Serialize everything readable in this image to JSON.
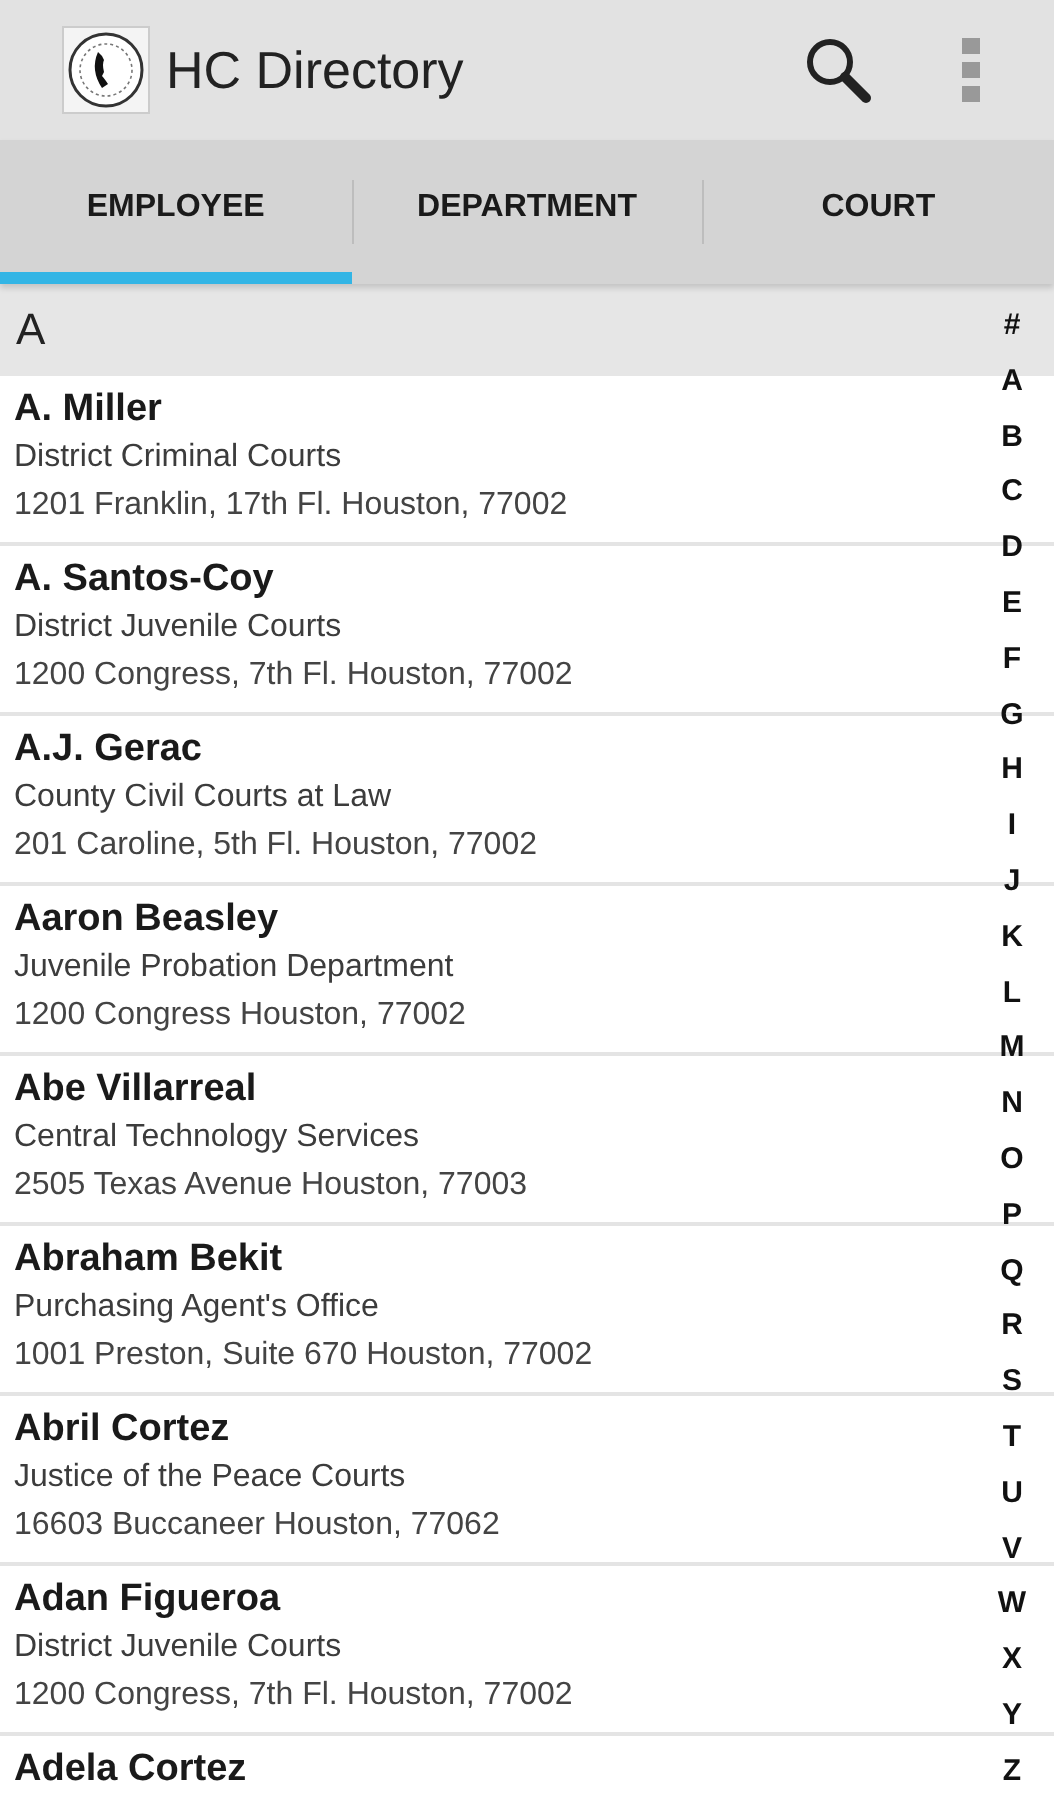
{
  "app_bar": {
    "title": "HC Directory"
  },
  "tabs": [
    {
      "label": "EMPLOYEE",
      "selected": true
    },
    {
      "label": "DEPARTMENT",
      "selected": false
    },
    {
      "label": "COURT",
      "selected": false
    }
  ],
  "section_header": "A",
  "employees": [
    {
      "name": "A. Miller",
      "department": "District Criminal Courts",
      "address": "1201 Franklin, 17th Fl. Houston, 77002"
    },
    {
      "name": "A. Santos-Coy",
      "department": "District Juvenile Courts",
      "address": "1200 Congress, 7th Fl. Houston, 77002"
    },
    {
      "name": "A.J. Gerac",
      "department": "County Civil Courts at Law",
      "address": "201 Caroline, 5th Fl. Houston, 77002"
    },
    {
      "name": "Aaron Beasley",
      "department": "Juvenile Probation Department",
      "address": "1200 Congress Houston, 77002"
    },
    {
      "name": "Abe Villarreal",
      "department": "Central Technology Services",
      "address": "2505 Texas Avenue Houston, 77003"
    },
    {
      "name": "Abraham Bekit",
      "department": "Purchasing Agent's Office",
      "address": "1001 Preston, Suite 670 Houston, 77002"
    },
    {
      "name": "Abril Cortez",
      "department": "Justice of the Peace Courts",
      "address": "16603 Buccaneer Houston, 77062"
    },
    {
      "name": "Adan Figueroa",
      "department": "District Juvenile Courts",
      "address": "1200 Congress, 7th Fl. Houston, 77002"
    },
    {
      "name": "Adela Cortez"
    }
  ],
  "alphabet_index": [
    "#",
    "A",
    "B",
    "C",
    "D",
    "E",
    "F",
    "G",
    "H",
    "I",
    "J",
    "K",
    "L",
    "M",
    "N",
    "O",
    "P",
    "Q",
    "R",
    "S",
    "T",
    "U",
    "V",
    "W",
    "X",
    "Y",
    "Z"
  ]
}
